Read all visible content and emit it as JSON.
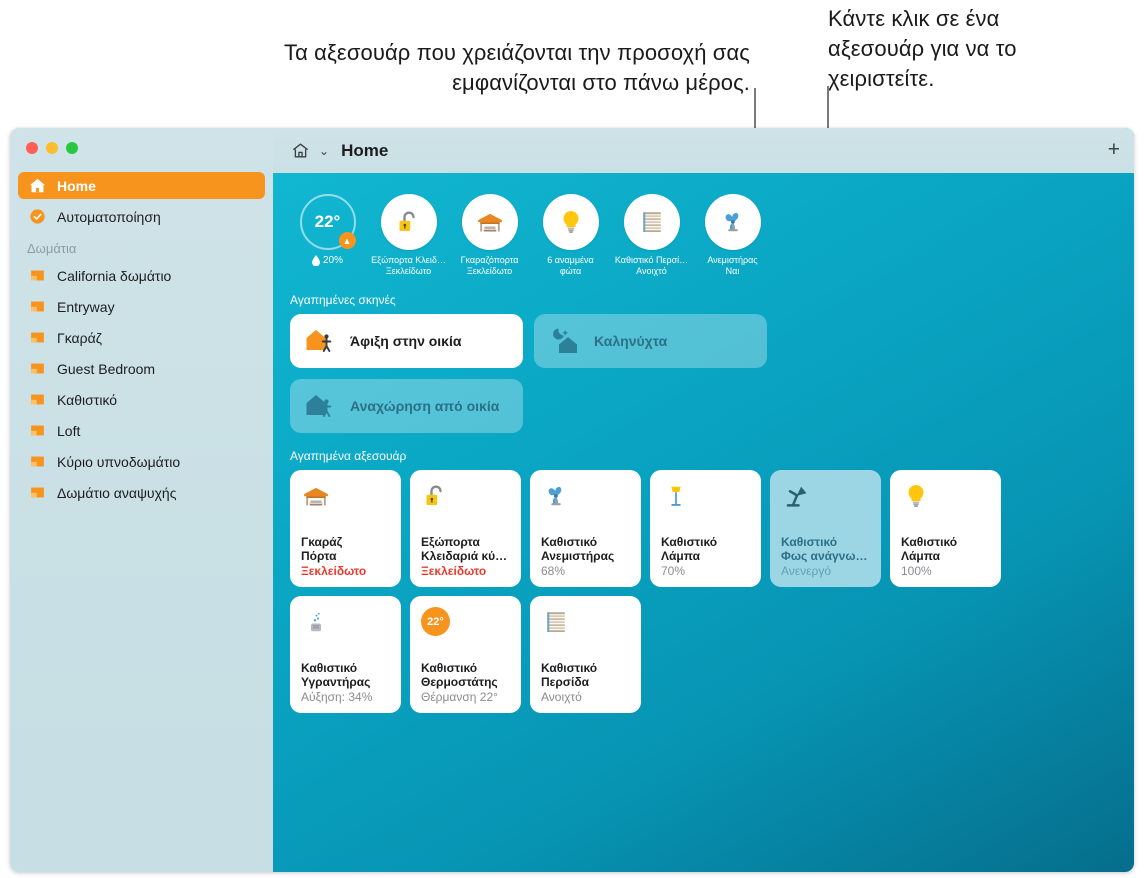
{
  "callouts": {
    "left": "Τα αξεσουάρ που χρειάζονται την προσοχή σας εμφανίζονται στο πάνω μέρος.",
    "right": "Κάντε κλικ σε ένα αξεσουάρ για να το χειριστείτε."
  },
  "window": {
    "titlebar": {
      "home_icon": "home-icon",
      "chevron": "⌄",
      "title": "Home",
      "add_label": "+"
    }
  },
  "sidebar": {
    "items": [
      {
        "label": "Home",
        "icon": "home-icon",
        "selected": true
      },
      {
        "label": "Αυτοματοποίηση",
        "icon": "automation-clock-icon",
        "selected": false
      }
    ],
    "rooms_header": "Δωμάτια",
    "rooms": [
      {
        "label": "California δωμάτιο",
        "icon": "room-icon"
      },
      {
        "label": "Entryway",
        "icon": "room-icon"
      },
      {
        "label": "Γκαράζ",
        "icon": "room-icon"
      },
      {
        "label": "Guest Bedroom",
        "icon": "room-icon"
      },
      {
        "label": "Καθιστικό",
        "icon": "room-icon"
      },
      {
        "label": "Loft",
        "icon": "room-icon"
      },
      {
        "label": "Κύριο υπνοδωμάτιο",
        "icon": "room-icon"
      },
      {
        "label": "Δωμάτιο αναψυχής",
        "icon": "room-icon"
      }
    ]
  },
  "status_strip": {
    "climate": {
      "temperature": "22°",
      "badge_icon": "arrow-up-icon",
      "humidity_icon": "droplet-icon",
      "humidity": "20%"
    },
    "items": [
      {
        "icon": "unlocked-padlock-icon",
        "label": "Εξώπορτα Κλειδ…",
        "state": "Ξεκλείδωτο"
      },
      {
        "icon": "garage-door-icon",
        "label": "Γκαραζόπορτα",
        "state": "Ξεκλείδωτο"
      },
      {
        "icon": "lightbulb-icon",
        "label": "6 αναμμένα",
        "state": "φώτα"
      },
      {
        "icon": "blinds-icon",
        "label": "Καθιστικό Περσί…",
        "state": "Ανοιχτό"
      },
      {
        "icon": "fan-icon",
        "label": "Ανεμιστήρας",
        "state": "Ναι"
      }
    ]
  },
  "scenes": {
    "title": "Αγαπημένες σκηνές",
    "items": [
      {
        "label": "Άφιξη στην οικία",
        "icon": "house-person-icon",
        "on": true
      },
      {
        "label": "Καληνύχτα",
        "icon": "moon-house-icon",
        "on": false
      },
      {
        "label": "Αναχώρηση από οικία",
        "icon": "house-person-icon",
        "on": false
      }
    ]
  },
  "accessories": {
    "title": "Αγαπημένα αξεσουάρ",
    "items": [
      {
        "icon": "garage-door-icon",
        "name_line1": "Γκαράζ",
        "name_line2": "Πόρτα",
        "state": "Ξεκλείδωτο",
        "state_style": "alert",
        "on": true,
        "selected": false
      },
      {
        "icon": "unlocked-padlock-icon",
        "name_line1": "Εξώπορτα",
        "name_line2": "Κλειδαριά κύ…",
        "state": "Ξεκλείδωτο",
        "state_style": "alert",
        "on": true,
        "selected": false
      },
      {
        "icon": "fan-icon",
        "name_line1": "Καθιστικό",
        "name_line2": "Ανεμιστήρας",
        "state": "68%",
        "state_style": "normal",
        "on": true,
        "selected": false
      },
      {
        "icon": "floor-lamp-icon",
        "name_line1": "Καθιστικό",
        "name_line2": "Λάμπα",
        "state": "70%",
        "state_style": "normal",
        "on": true,
        "selected": false
      },
      {
        "icon": "desk-lamp-icon",
        "name_line1": "Καθιστικό",
        "name_line2": "Φως ανάγνω…",
        "state": "Ανενεργό",
        "state_style": "normal",
        "on": false,
        "selected": true
      },
      {
        "icon": "lightbulb-icon",
        "name_line1": "Καθιστικό",
        "name_line2": "Λάμπα",
        "state": "100%",
        "state_style": "normal",
        "on": true,
        "selected": false
      },
      {
        "icon": "humidifier-icon",
        "name_line1": "Καθιστικό",
        "name_line2": "Υγραντήρας",
        "state": "Αύξηση: 34%",
        "state_style": "normal",
        "on": true,
        "selected": false
      },
      {
        "icon": "thermostat-icon",
        "badge_text": "22°",
        "name_line1": "Καθιστικό",
        "name_line2": "Θερμοστάτης",
        "state": "Θέρμανση 22°",
        "state_style": "normal",
        "on": true,
        "selected": false
      },
      {
        "icon": "blinds-icon",
        "name_line1": "Καθιστικό",
        "name_line2": "Περσίδα",
        "state": "Ανοιχτό",
        "state_style": "normal",
        "on": true,
        "selected": false
      }
    ]
  },
  "colors": {
    "accent_orange": "#f7941e",
    "alert_red": "#e8392c",
    "sidebar_bg": "#cbe1e6",
    "main_top": "#12b8d2",
    "main_bottom": "#056e8c",
    "off_tile": "#9cd6e4"
  }
}
